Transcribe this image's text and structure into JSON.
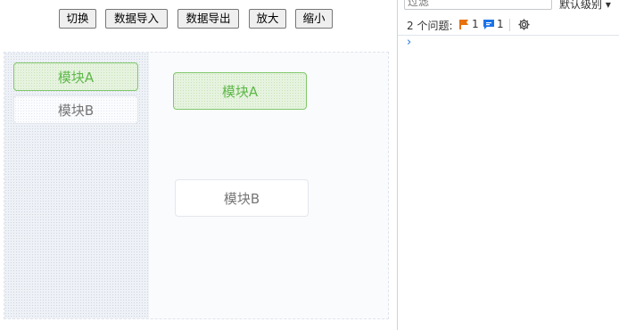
{
  "toolbar": {
    "buttons": [
      "切换",
      "数据导入",
      "数据导出",
      "放大",
      "缩小"
    ]
  },
  "palette": {
    "items": [
      {
        "label": "模块A",
        "active": true
      },
      {
        "label": "模块B",
        "active": false
      }
    ]
  },
  "canvas": {
    "nodes": [
      {
        "label": "模块A",
        "active": true
      },
      {
        "label": "模块B",
        "active": false
      }
    ]
  },
  "devtools": {
    "filter_placeholder": "过滤",
    "log_level": "默认级别 ▾",
    "issues_label": "2 个问题:",
    "warning_count": "1",
    "info_count": "1",
    "prompt_symbol": "›"
  },
  "colors": {
    "active_text": "#5fb84a",
    "active_border": "#7fc76a",
    "warning": "#e8710a",
    "info": "#1a73e8"
  },
  "icons": [
    "warning-flag-icon",
    "message-icon",
    "gear-icon",
    "prompt-chevron-icon"
  ]
}
